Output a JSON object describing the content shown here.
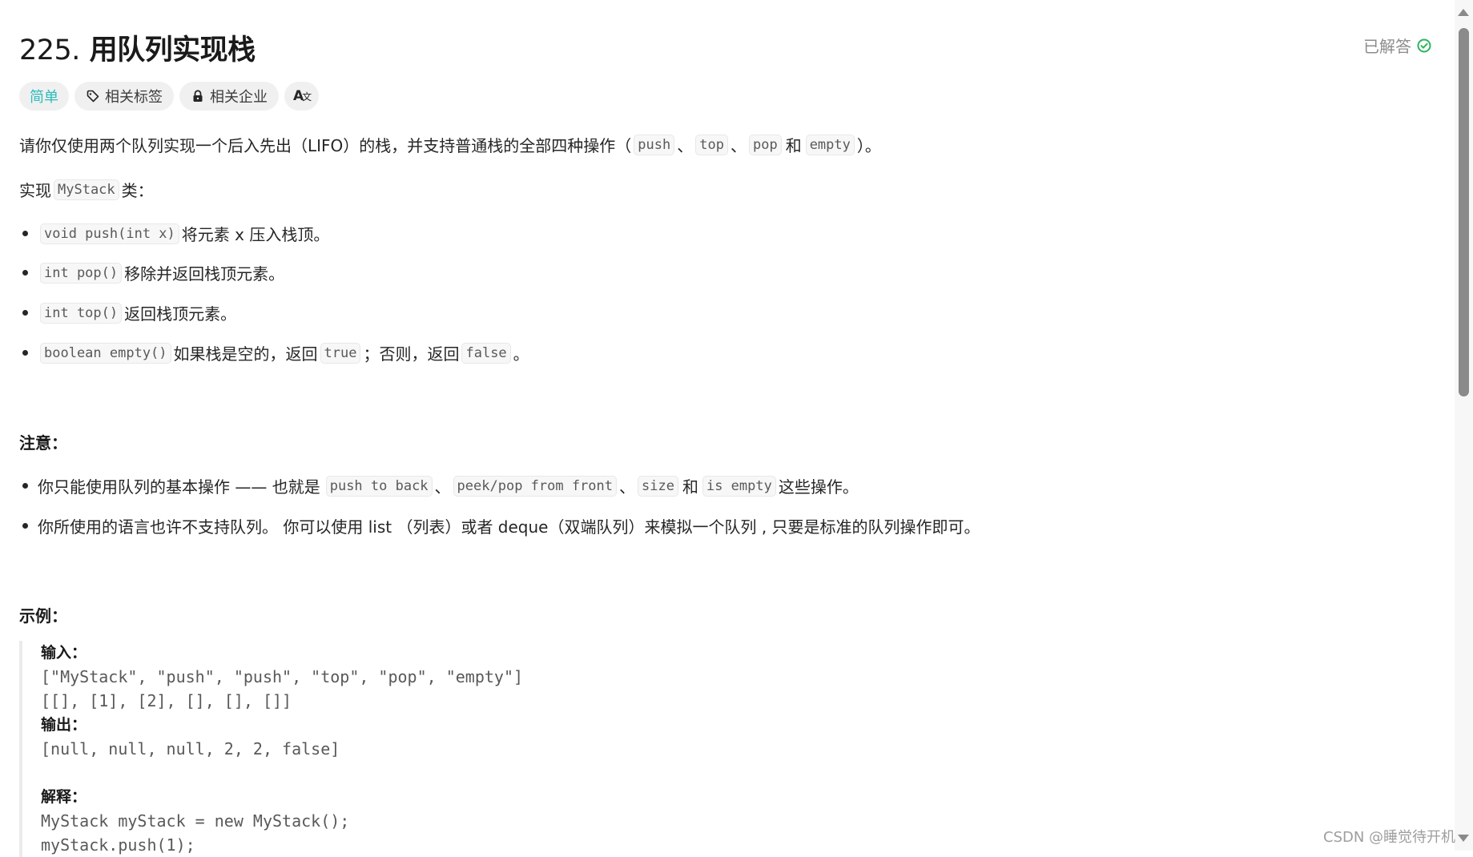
{
  "problem": {
    "number": "225.",
    "title": "用队列实现栈",
    "status": "已解答",
    "status_color": "#2db55d",
    "difficulty": "简单",
    "difficulty_color": "#2cbbbb",
    "tags": [
      {
        "icon": "tag-icon",
        "label": "相关标签"
      },
      {
        "icon": "lock-icon",
        "label": "相关企业"
      },
      {
        "icon": "translate-icon",
        "label": "Aあ"
      }
    ]
  },
  "description": {
    "intro": {
      "text": "请你仅使用两个队列实现一个后入先出（LIFO）的栈，并支持普通栈的全部四种操作（",
      "ops": [
        "push",
        "top",
        "pop",
        "empty"
      ],
      "sep": "、",
      "and": "和",
      "end": "）。"
    },
    "implement": {
      "prefix": "实现",
      "code": "MyStack",
      "suffix": "类："
    },
    "methods": [
      {
        "code": "void push(int x)",
        "text": "将元素 x 压入栈顶。"
      },
      {
        "code": "int pop()",
        "text": "移除并返回栈顶元素。"
      },
      {
        "code": "int top()",
        "text": "返回栈顶元素。"
      },
      {
        "code": "boolean empty()",
        "text": "如果栈是空的，返回",
        "code2": "true",
        "text2": "；否则，返回",
        "code3": "false",
        "text3": "。"
      }
    ],
    "note_heading": "注意：",
    "notes": [
      {
        "text": "你只能使用队列的基本操作 —— 也就是",
        "codes": [
          "push to back",
          "peek/pop from front",
          "size",
          "is empty"
        ],
        "sep": "、",
        "and": "和",
        "end": "这些操作。"
      },
      {
        "text": "你所使用的语言也许不支持队列。 你可以使用 list （列表）或者 deque（双端队列）来模拟一个队列 , 只要是标准的队列操作即可。"
      }
    ],
    "example_heading": "示例："
  },
  "example": {
    "input_label": "输入：",
    "input_line1": "[\"MyStack\", \"push\", \"push\", \"top\", \"pop\", \"empty\"]",
    "input_line2": "[[], [1], [2], [], [], []]",
    "output_label": "输出：",
    "output_line": "[null, null, null, 2, 2, false]",
    "explain_label": "解释：",
    "explain_lines": [
      "MyStack myStack = new MyStack();",
      "myStack.push(1);"
    ]
  },
  "watermark": "CSDN @睡觉待开机"
}
